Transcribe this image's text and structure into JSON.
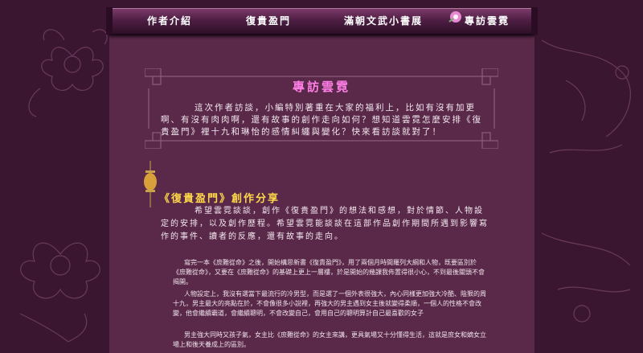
{
  "nav": {
    "items": [
      "作者介紹",
      "復貴盈門",
      "滿朝文武小書展",
      "專訪雲霓"
    ]
  },
  "section": {
    "title": "專訪雲霓",
    "intro": "這次作者訪談，小編特別著重在大家的福利上，比如有沒有加更啊、有沒有肉肉啊，還有故事的創作走向如何？想知道雲霓怎麼安排《復貴盈門》裡十九和琳怡的感情糾纏與變化？快來看訪談就對了！"
  },
  "subsection": {
    "title": "《復貴盈門》創作分享",
    "intro": "希望雲霓談談，創作《復貴盈門》的想法和感想，對於情節、人物設定的安排，以及創作歷程。希望雲霓能談談在這部作品創作期間所遇到影響寫作的事件、讀者的反應，還有故事的走向。"
  },
  "body": [
    "寫完一本《庶難從命》之後，開始構思新書《復貴盈門》，用了兩個月時間羅列大綱和人物，既要區別於《庶難從命》，又要在《庶難從命》的基礎上更上一層樓，於是開始的幾課我佈置得很小心，不到最後關頭不會揭開。",
    "人物設定上，我沒有選當下最流行的冷男型，而是選了一個外表很強大，內心同樣更加強大冷酷、陰狠的周十九，男主最大的亮點在於，不會像很多小說裡，再強大的男主遇到女主後就變得柔順，一個人的性格不會改變，他會繼續霸道，會繼續聰明，不會改變自己，會用自己的聰明算計自己最喜歡的女子",
    "男主強大同時又孩子氣，女主比《庶難從命》的女主來講，更具氣場又十分懂得生活，這就是庶女和嫡女立場上和後天養成上的區別。"
  ],
  "colors": {
    "accent_pink": "#ff7fe8",
    "accent_gold": "#ffd84a",
    "panel": "#5a2848",
    "background": "#3a1630"
  }
}
